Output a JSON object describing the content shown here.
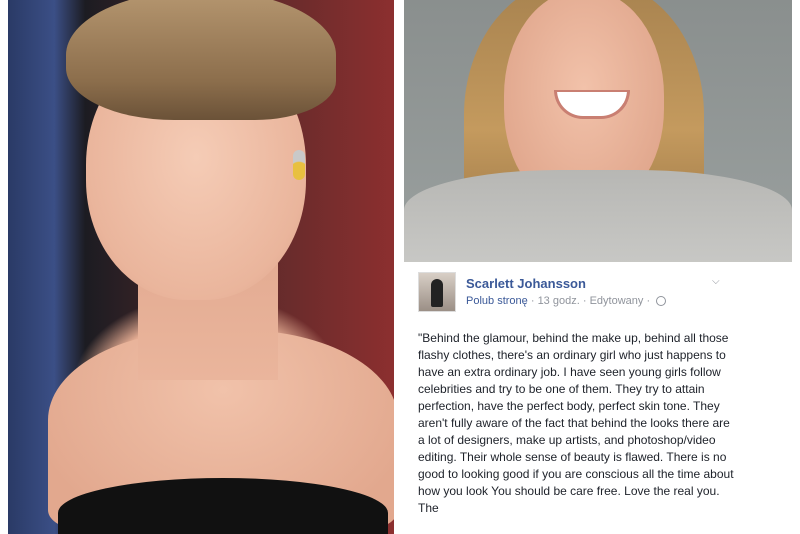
{
  "post": {
    "author": "Scarlett Johansson",
    "like_page": "Polub stronę",
    "time": "13 godz.",
    "edited": "Edytowany",
    "separator": "·",
    "body": "\"Behind the glamour, behind the make up, behind all those flashy clothes, there's an ordinary girl who just happens to have an extra ordinary job. I have seen young girls follow celebrities and try to be one of them. They try to attain perfection, have the perfect body, perfect skin tone. They aren't fully aware of the fact that behind the looks there are a lot of designers, make up artists, and photoshop/video editing. Their whole sense of beauty is flawed. There is no good to looking good if you are conscious all the time about how you look You should be care free. Love the real you. The"
  },
  "icons": {
    "options": "chevron-down-icon",
    "audience": "globe-icon"
  }
}
